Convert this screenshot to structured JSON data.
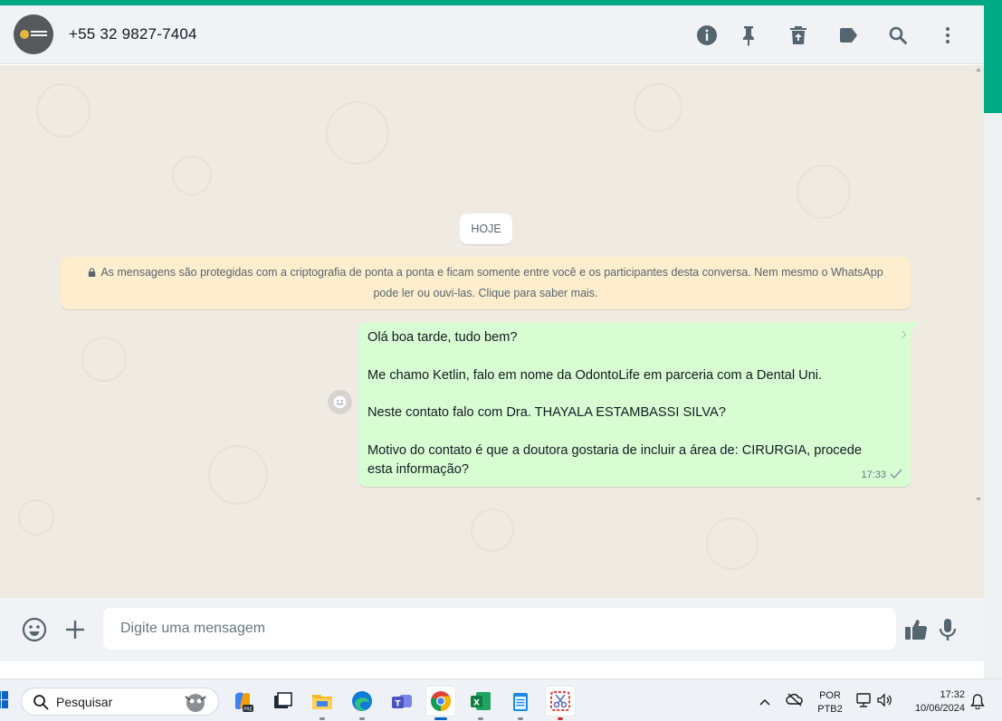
{
  "header": {
    "contact_name": "+55 32 9827-7404",
    "avatar_icon": "business-logo-avatar",
    "icons": [
      "info-icon",
      "pin-icon",
      "delete-icon",
      "label-icon",
      "search-icon",
      "menu-icon"
    ]
  },
  "chat": {
    "day_divider": "HOJE",
    "encryption_notice": "As mensagens são protegidas com a criptografia de ponta a ponta e ficam somente entre você e os participantes desta conversa. Nem mesmo o WhatsApp pode ler ou ouvi-las. Clique para saber mais.",
    "message": {
      "lines": [
        "Olá boa tarde, tudo bem?",
        "Me chamo Ketlin, falo em nome da OdontoLife em parceria com a Dental Uni.",
        "Neste contato falo com Dra. THAYALA ESTAMBASSI SILVA?",
        "Motivo do contato é que a doutora gostaria de incluir a área de: CIRURGIA, procede",
        "esta informação?"
      ],
      "time": "17:33",
      "status": "sent"
    }
  },
  "composer": {
    "placeholder": "Digite uma mensagem"
  },
  "taskbar": {
    "search_label": "Pesquisar",
    "apps": [
      "copilot-icon",
      "task-view-icon",
      "file-explorer-icon",
      "edge-icon",
      "teams-icon",
      "chrome-icon",
      "excel-icon",
      "notepad-icon",
      "snipping-tool-icon"
    ],
    "active_app": "chrome-icon",
    "language": "POR",
    "keyboard": "PTB2",
    "time": "17:32",
    "date": "10/06/2024"
  },
  "colors": {
    "accent": "#00a884",
    "outgoing_bubble": "#d9fdd3",
    "chat_background": "#efeae2",
    "notice_background": "#ffeecd",
    "panel": "#f0f2f5"
  }
}
